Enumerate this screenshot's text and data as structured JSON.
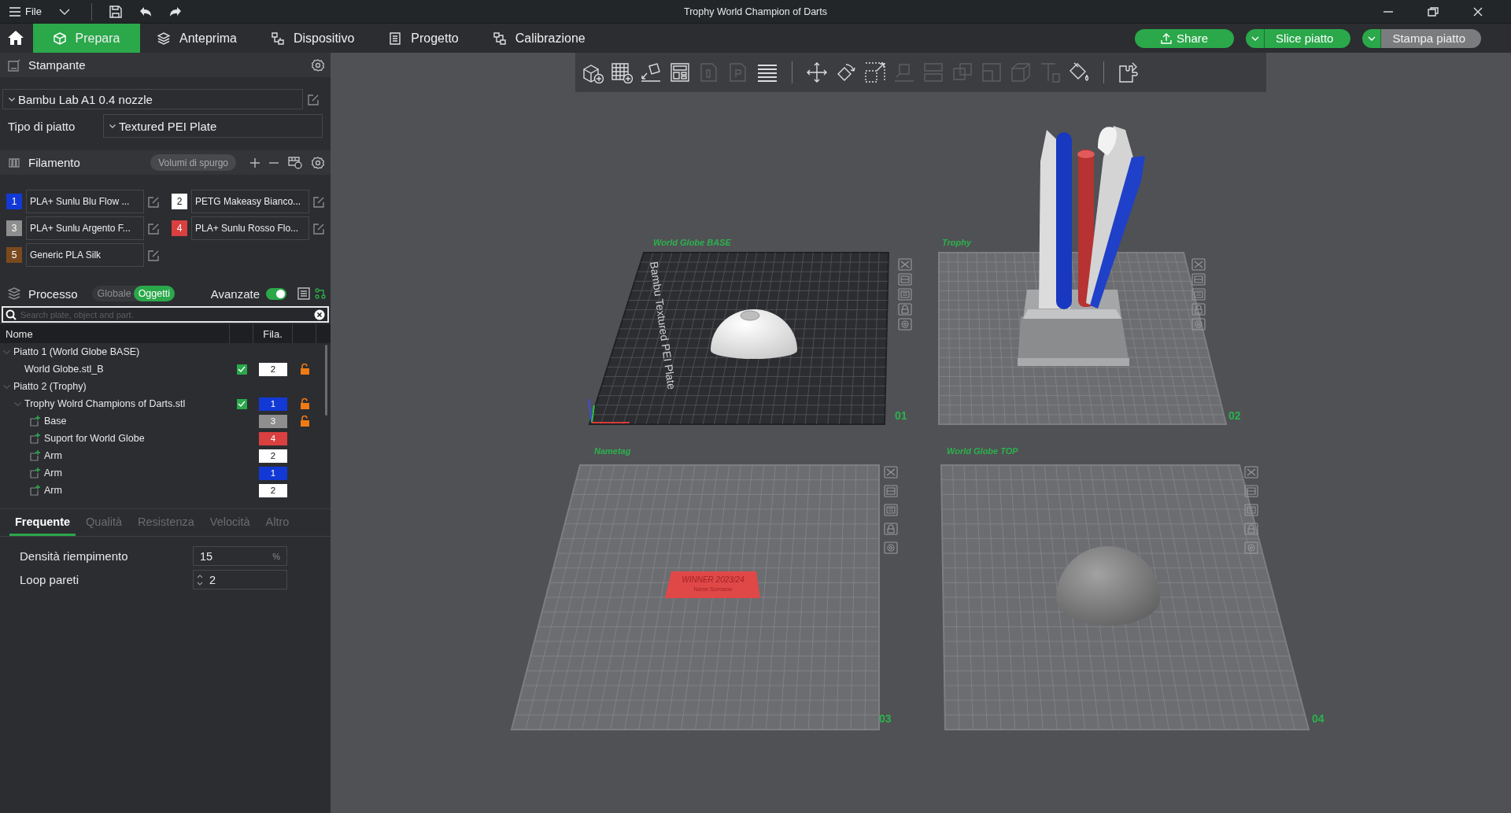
{
  "window": {
    "title": "Trophy World Champion of Darts"
  },
  "menu": {
    "label": "File"
  },
  "nav_tabs": [
    {
      "label": "Prepara",
      "selected": true
    },
    {
      "label": "Anteprima",
      "selected": false
    },
    {
      "label": "Dispositivo",
      "selected": false
    },
    {
      "label": "Progetto",
      "selected": false
    },
    {
      "label": "Calibrazione",
      "selected": false
    }
  ],
  "actions": [
    {
      "label": "Share",
      "kind": "share"
    },
    {
      "label": "Slice piatto",
      "kind": "split",
      "disabled": false
    },
    {
      "label": "Stampa piatto",
      "kind": "split",
      "disabled": true
    }
  ],
  "printer": {
    "title": "Stampante",
    "preset": "Bambu Lab A1 0.4 nozzle",
    "plate_type_label": "Tipo di piatto",
    "plate_type": "Textured PEI Plate"
  },
  "filament": {
    "title": "Filamento",
    "purge_button": "Volumi di spurgo",
    "items": [
      {
        "index": "1",
        "name": "PLA+ Sunlu Blu Flow ...",
        "color": "#1239d6"
      },
      {
        "index": "2",
        "name": "PETG Makeasy Bianco...",
        "color": "#ffffff"
      },
      {
        "index": "3",
        "name": "PLA+ Sunlu Argento F...",
        "color": "#8e8e8e"
      },
      {
        "index": "4",
        "name": "PLA+ Sunlu Rosso Flo...",
        "color": "#d9403f"
      },
      {
        "index": "5",
        "name": "Generic PLA Silk",
        "color": "#7a4a1e"
      }
    ]
  },
  "process": {
    "title": "Processo",
    "modes": [
      {
        "label": "Globale",
        "selected": false
      },
      {
        "label": "Oggetti",
        "selected": true
      }
    ],
    "advanced_label": "Avanzate",
    "advanced_on": true
  },
  "search": {
    "placeholder": "Search plate, object and part."
  },
  "object_list": {
    "columns": [
      "Nome",
      "Fila."
    ],
    "rows": [
      {
        "kind": "plate",
        "name": "Piatto 1 (World Globe BASE)",
        "expanded": true,
        "children": [
          {
            "kind": "object",
            "name": "World Globe.stl_B",
            "checked": true,
            "filament": "2",
            "color": "#ffffff",
            "lock": true
          }
        ]
      },
      {
        "kind": "plate",
        "name": "Piatto 2 (Trophy)",
        "expanded": true,
        "children": [
          {
            "kind": "object",
            "name": "Trophy Wolrd Champions of Darts.stl",
            "checked": true,
            "filament": "1",
            "color": "#1239d6",
            "lock": true,
            "expanded": true,
            "children": [
              {
                "kind": "part",
                "name": "Base",
                "filament": "3",
                "color": "#8e8e8e",
                "lock": true
              },
              {
                "kind": "part",
                "name": "Suport for World Globe",
                "filament": "4",
                "color": "#d9403f",
                "lock": false
              },
              {
                "kind": "part",
                "name": "Arm",
                "filament": "2",
                "color": "#ffffff",
                "lock": false
              },
              {
                "kind": "part",
                "name": "Arm",
                "filament": "1",
                "color": "#1239d6",
                "lock": false
              },
              {
                "kind": "part",
                "name": "Arm",
                "filament": "2",
                "color": "#ffffff",
                "lock": false
              }
            ]
          }
        ]
      }
    ]
  },
  "settings_tabs": [
    {
      "label": "Frequente",
      "selected": true
    },
    {
      "label": "Qualità",
      "selected": false
    },
    {
      "label": "Resistenza",
      "selected": false
    },
    {
      "label": "Velocità",
      "selected": false
    },
    {
      "label": "Altro",
      "selected": false
    }
  ],
  "settings": [
    {
      "label": "Densità riempimento",
      "value": "15",
      "unit": "%",
      "kind": "unit"
    },
    {
      "label": "Loop pareti",
      "value": "2",
      "kind": "spin"
    }
  ],
  "toolbar": [
    {
      "kind": "add_object",
      "disabled": false
    },
    {
      "kind": "add_plate",
      "disabled": false
    },
    {
      "kind": "auto_orient",
      "disabled": false
    },
    {
      "kind": "arrange",
      "disabled": false
    },
    {
      "kind": "plate_o",
      "disabled": true
    },
    {
      "kind": "plate_p",
      "disabled": true
    },
    {
      "kind": "layers",
      "disabled": false
    },
    {
      "kind": "separator"
    },
    {
      "kind": "move",
      "disabled": false
    },
    {
      "kind": "rotate",
      "disabled": false
    },
    {
      "kind": "scale",
      "disabled": false
    },
    {
      "kind": "lay_flat",
      "disabled": true
    },
    {
      "kind": "cut",
      "disabled": true
    },
    {
      "kind": "boolean",
      "disabled": true
    },
    {
      "kind": "support",
      "disabled": true
    },
    {
      "kind": "seam",
      "disabled": true
    },
    {
      "kind": "text",
      "disabled": true
    },
    {
      "kind": "paint",
      "disabled": false
    },
    {
      "kind": "separator"
    },
    {
      "kind": "assembly",
      "disabled": false
    }
  ],
  "plates": [
    {
      "name": "World Globe BASE",
      "number": "01",
      "selected": true,
      "bed_text": "Bambu Textured PEI Plate",
      "kind": "dome"
    },
    {
      "name": "Trophy",
      "number": "02",
      "selected": false,
      "kind": "trophy"
    },
    {
      "name": "Nametag",
      "number": "03",
      "selected": false,
      "kind": "tag",
      "tag_lines": [
        "WINNER 2023/24",
        "Name Surname"
      ]
    },
    {
      "name": "World Globe TOP",
      "number": "04",
      "selected": false,
      "kind": "sphere"
    }
  ]
}
